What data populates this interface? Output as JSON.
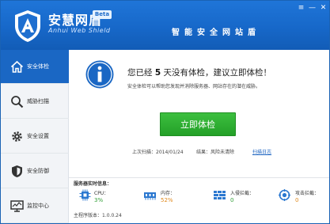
{
  "header": {
    "title": "安慧网盾",
    "beta_badge": "Beta",
    "subtitle": "Anhui Web Shield",
    "slogan": "智能安全网站盾"
  },
  "window_controls": {
    "menu": "≡",
    "minimize": "—",
    "close": "✕"
  },
  "sidebar": {
    "items": [
      {
        "label": "安全体检",
        "icon": "home-icon",
        "active": true
      },
      {
        "label": "威胁扫描",
        "icon": "magnifier-icon",
        "active": false
      },
      {
        "label": "安全设置",
        "icon": "gear-icon",
        "active": false
      },
      {
        "label": "安全防御",
        "icon": "shield-icon",
        "active": false
      },
      {
        "label": "监控中心",
        "icon": "monitor-icon",
        "active": false
      }
    ]
  },
  "main": {
    "headline_prefix": "您已经",
    "headline_days": "5",
    "headline_suffix": "天没有体检，建议立即体检！",
    "subtitle": "安全体检可以帮助您发现并消除服务器、网站存在的潜在威胁。",
    "cta_label": "立即体检",
    "last_scan": "上次扫描：2014/01/24",
    "result": "结果：风险未清除",
    "scan_log": "扫描日志"
  },
  "monitor": {
    "title": "服务器实时信息：",
    "metrics": [
      {
        "label": "CPU：",
        "value": "3%",
        "icon": "cpu-icon"
      },
      {
        "label": "内存：",
        "value": "52%",
        "icon": "memory-icon"
      },
      {
        "label": "入侵拦截：",
        "value": "0",
        "icon": "intrusion-icon"
      },
      {
        "label": "攻击拦截：",
        "value": "0",
        "icon": "attack-icon"
      }
    ]
  },
  "footer": {
    "version": "主程序版本：1.0.0.24"
  },
  "colors": {
    "brand_blue": "#1a67c4",
    "cta_green": "#2bab2f",
    "value_green": "#36a03b",
    "value_orange": "#e08a1e"
  }
}
